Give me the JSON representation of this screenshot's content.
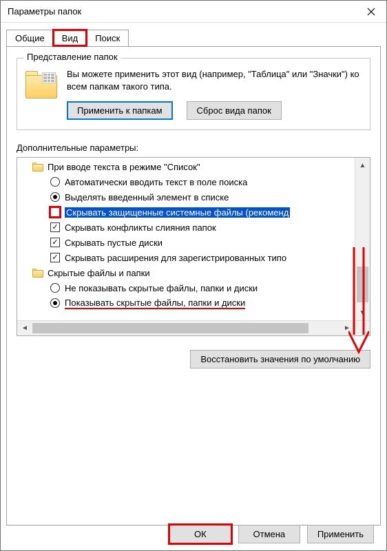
{
  "window": {
    "title": "Параметры папок"
  },
  "tabs": {
    "general": "Общие",
    "view": "Вид",
    "search": "Поиск",
    "active": "view"
  },
  "groupbox": {
    "legend": "Представление папок",
    "description": "Вы можете применить этот вид (например, \"Таблица\" или \"Значки\") ко всем папкам такого типа.",
    "apply_btn": "Применить к папкам",
    "reset_btn": "Сброс вида папок"
  },
  "advanced": {
    "label": "Дополнительные параметры:",
    "items": [
      {
        "type": "folder",
        "label": "При вводе текста в режиме \"Список\""
      },
      {
        "type": "radio",
        "selected": false,
        "label": "Автоматически вводить текст в поле поиска"
      },
      {
        "type": "radio",
        "selected": true,
        "label": "Выделять введенный элемент в списке"
      },
      {
        "type": "check",
        "selected": false,
        "highlighted": true,
        "row_selected": true,
        "label": "Скрывать защищенные системные файлы (рекоменд"
      },
      {
        "type": "check",
        "selected": true,
        "label": "Скрывать конфликты слияния папок"
      },
      {
        "type": "check",
        "selected": true,
        "label": "Скрывать пустые диски"
      },
      {
        "type": "check",
        "selected": true,
        "label": "Скрывать расширения для зарегистрированных типо"
      },
      {
        "type": "folder",
        "label": "Скрытые файлы и папки"
      },
      {
        "type": "radio",
        "selected": false,
        "label": "Не показывать скрытые файлы, папки и диски"
      },
      {
        "type": "radio",
        "selected": true,
        "underline": true,
        "label": "Показывать скрытые файлы, папки и диски"
      }
    ]
  },
  "restore_defaults": "Восстановить значения по умолчанию",
  "buttons": {
    "ok": "ОК",
    "cancel": "Отмена",
    "apply": "Применить"
  }
}
